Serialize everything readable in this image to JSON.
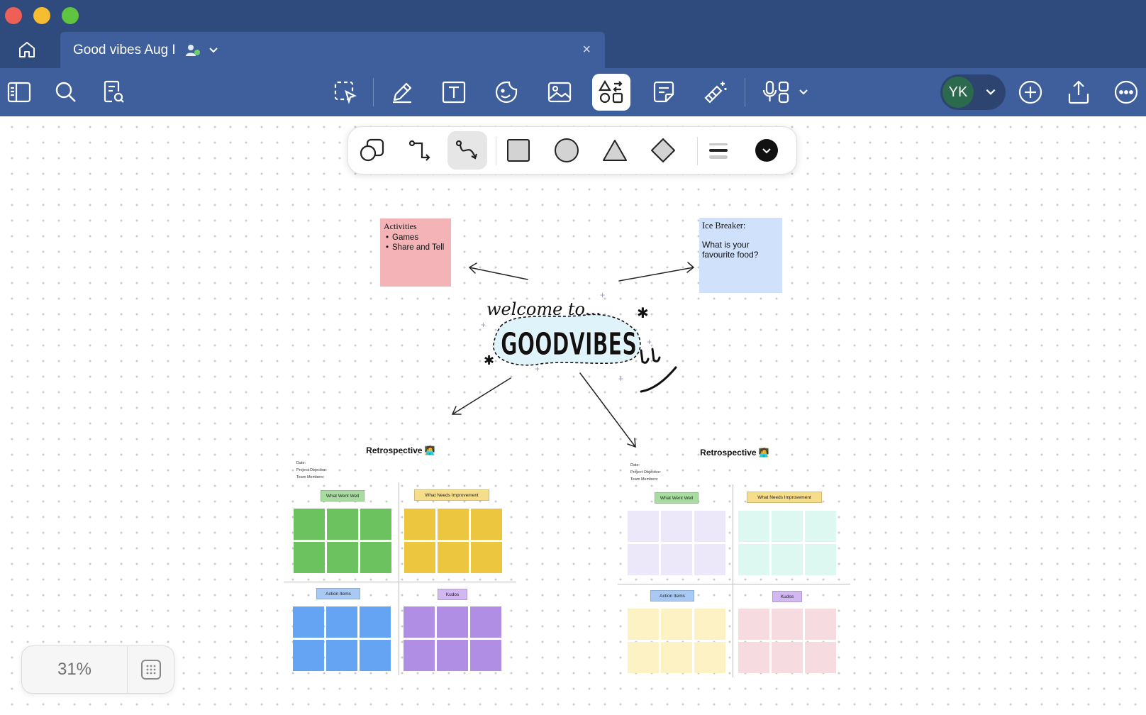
{
  "app": {
    "tab_title": "Good vibes Aug I",
    "tab_close_glyph": "×",
    "home_icon": "house-icon"
  },
  "toolbar": {
    "left_tools": [
      "sidebar-icon",
      "search-icon",
      "document-search-icon"
    ],
    "center_tools": [
      "lasso-select-icon",
      "pen-icon",
      "text-box-icon",
      "sticker-icon",
      "image-icon",
      "shapes-icon",
      "sticky-note-icon",
      "magic-wand-icon",
      "audio-record-icon"
    ],
    "active_tool": "shapes-icon",
    "avatar_initials": "YK",
    "right_tools": [
      "add-icon",
      "share-icon",
      "more-icon"
    ]
  },
  "shape_palette": {
    "tools": [
      "shape-recognition-icon",
      "elbow-connector-icon",
      "curved-connector-icon",
      "square-icon",
      "circle-icon",
      "triangle-icon",
      "diamond-icon",
      "line-weight-icon",
      "color-swatch-icon"
    ],
    "active": "curved-connector-icon",
    "color": "#111111"
  },
  "stickies": {
    "activities": {
      "title": "Activities",
      "items": [
        "Games",
        "Share and Tell"
      ],
      "color": "#f4b3b6"
    },
    "icebreaker": {
      "title": "Ice Breaker:",
      "body": "What is your favourite food?",
      "color": "#cfe1fb"
    }
  },
  "welcome": {
    "line1": "welcome to...",
    "line2": "GOODVIBES"
  },
  "retros": [
    {
      "title": "Retrospective 🧑‍💻",
      "meta": [
        "Date:",
        "Project Objective:",
        "Team Members:"
      ],
      "quadrants": [
        {
          "label": "What Went Well",
          "label_color": "#a8dca0",
          "note_color": "#6cc25e"
        },
        {
          "label": "What Needs Improvement",
          "label_color": "#f6dd8a",
          "note_color": "#ecc63e"
        },
        {
          "label": "Action Items",
          "label_color": "#a9c9f5",
          "note_color": "#64a4f2"
        },
        {
          "label": "Kudos",
          "label_color": "#d2b8f0",
          "note_color": "#b08ee4"
        }
      ]
    },
    {
      "title": "Retrospective 🧑‍💻",
      "meta": [
        "Date:",
        "Project Objective:",
        "Team Members:"
      ],
      "quadrants": [
        {
          "label": "What Went Well",
          "label_color": "#a8dca0",
          "note_color": "#ece8fa"
        },
        {
          "label": "What Needs Improvement",
          "label_color": "#f6dd8a",
          "note_color": "#dcf8f0"
        },
        {
          "label": "Action Items",
          "label_color": "#a9c9f5",
          "note_color": "#fdf2c4"
        },
        {
          "label": "Kudos",
          "label_color": "#d2b8f0",
          "note_color": "#f6dbe0"
        }
      ]
    }
  ],
  "zoom": {
    "level": "31%",
    "grid_icon": "canvas-grid-icon"
  },
  "colors": {
    "titlebar": "#2f4a7c",
    "toolbar": "#3e5f9b"
  }
}
